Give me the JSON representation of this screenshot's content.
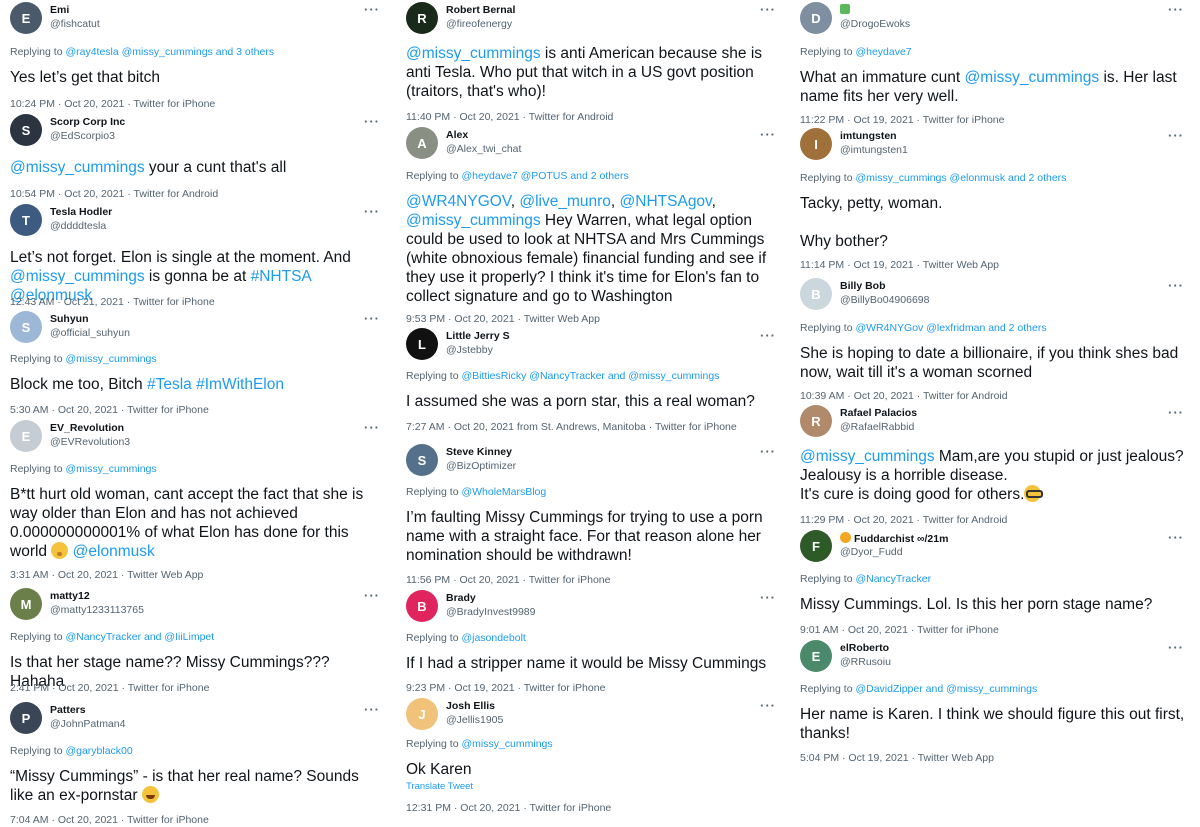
{
  "columns": [
    [
      {
        "name": "Emi",
        "handle": "@fishcatut",
        "avatar_color": "#4a5a6a",
        "reply_prefix": "Replying to ",
        "reply_to": "@ray4tesla @missy_cummings and 3 others",
        "body": [
          {
            "t": "Yes let’s get that bitch"
          }
        ],
        "meta": "10:24 PM · Oct 20, 2021 · Twitter for iPhone"
      },
      {
        "name": "Scorp Corp Inc",
        "handle": "@EdScorpio3",
        "avatar_color": "#2b3440",
        "body": [
          {
            "t": "@missy_cummings",
            "link": true
          },
          {
            "t": " your a cunt that's all"
          }
        ],
        "meta": "10:54 PM · Oct 20, 2021 · Twitter for Android"
      },
      {
        "name": "Tesla Hodler",
        "handle": "@ddddtesla",
        "avatar_color": "#3d5a80",
        "body": [
          {
            "t": "Let’s not forget. Elon is single at the moment. And "
          },
          {
            "t": "@missy_cummings",
            "link": true
          },
          {
            "t": " is gonna be at "
          },
          {
            "t": "#NHTSA",
            "link": true
          },
          {
            "t": " "
          },
          {
            "t": "@elonmusk",
            "link": true
          }
        ],
        "meta": "12:43 AM · Oct 21, 2021 · Twitter for iPhone"
      },
      {
        "name": "Suhyun",
        "handle": "@official_suhyun",
        "avatar_color": "#9db7d6",
        "reply_prefix": "Replying to ",
        "reply_to": "@missy_cummings",
        "body": [
          {
            "t": "Block me too, Bitch "
          },
          {
            "t": "#Tesla",
            "link": true
          },
          {
            "t": " "
          },
          {
            "t": "#ImWithElon",
            "link": true
          }
        ],
        "meta": "5:30 AM · Oct 20, 2021 · Twitter for iPhone"
      },
      {
        "name": "EV_Revolution",
        "handle": "@EVRevolution3",
        "avatar_color": "#c5ccd3",
        "reply_prefix": "Replying to ",
        "reply_to": "@missy_cummings",
        "body": [
          {
            "t": "B*tt hurt old woman, cant accept the fact that she is way older than Elon and has not achieved 0.000000000001% of what Elon has done for this world "
          },
          {
            "emoji": "hush"
          },
          {
            "t": " "
          },
          {
            "t": "@elonmusk",
            "link": true
          }
        ],
        "meta": "3:31 AM · Oct 20, 2021 · Twitter Web App"
      },
      {
        "name": "matty12",
        "handle": "@matty1233113765",
        "avatar_color": "#6b7f4a",
        "reply_prefix": "Replying to ",
        "reply_to": "@NancyTracker and @IiiLimpet",
        "body": [
          {
            "t": "Is that her stage name?? Missy Cummings???  Hahaha"
          }
        ],
        "meta": "2:41 PM · Oct 20, 2021 · Twitter for iPhone"
      },
      {
        "name": "Patters",
        "handle": "@JohnPatman4",
        "avatar_color": "#3a4556",
        "reply_prefix": "Replying to ",
        "reply_to": "@garyblack00",
        "body": [
          {
            "t": "“Missy Cummings” - is that her real name? Sounds like an ex-pornstar "
          },
          {
            "emoji": "joy"
          }
        ],
        "meta": "7:04 AM · Oct 20, 2021 · Twitter for iPhone"
      }
    ],
    [
      {
        "name": "Robert Bernal",
        "handle": "@fireofenergy",
        "avatar_color": "#1a2a1a",
        "body": [
          {
            "t": "@missy_cummings",
            "link": true
          },
          {
            "t": " is anti American because she is anti Tesla. Who put that witch in a US govt position (traitors, that's who)!"
          }
        ],
        "meta": "11:40 PM · Oct 20, 2021 · Twitter for Android"
      },
      {
        "name": "Alex",
        "handle": "@Alex_twi_chat",
        "avatar_color": "#8a8f84",
        "reply_prefix": "Replying to ",
        "reply_to": "@heydave7 @POTUS and 2 others",
        "body": [
          {
            "t": "@WR4NYGOV",
            "link": true
          },
          {
            "t": ", "
          },
          {
            "t": "@live_munro",
            "link": true
          },
          {
            "t": ", "
          },
          {
            "t": "@NHTSAgov",
            "link": true
          },
          {
            "t": ", "
          },
          {
            "t": "@missy_cummings",
            "link": true
          },
          {
            "t": " Hey Warren, what legal option could be used to look at NHTSA and Mrs Cummings (white obnoxious female) financial funding and  see if they use it properly? I think it's time for Elon's fan to collect signature and go to Washington"
          }
        ],
        "meta": "9:53 PM · Oct 20, 2021 · Twitter Web App"
      },
      {
        "name": "Little Jerry S",
        "handle": "@Jstebby",
        "avatar_color": "#111111",
        "reply_prefix": "Replying to ",
        "reply_to": "@BittiesRicky @NancyTracker and @missy_cummings",
        "body": [
          {
            "t": "I assumed she was a porn star, this a real woman?"
          }
        ],
        "meta": "7:27 AM · Oct 20, 2021 from St. Andrews, Manitoba · Twitter for iPhone"
      },
      {
        "name": "Steve Kinney",
        "handle": "@BizOptimizer",
        "avatar_color": "#55708a",
        "reply_prefix": "Replying to ",
        "reply_to": "@WholeMarsBlog",
        "body": [
          {
            "t": "I’m faulting Missy Cummings for trying to use a porn name with a straight face.  For that reason alone her nomination should be withdrawn!"
          }
        ],
        "meta": "11:56 PM · Oct 20, 2021 · Twitter for iPhone"
      },
      {
        "name": "Brady",
        "handle": "@BradyInvest9989",
        "avatar_color": "#e0245e",
        "reply_prefix": "Replying to ",
        "reply_to": "@jasondebolt",
        "body": [
          {
            "t": "If I had a stripper name it would be Missy Cummings"
          }
        ],
        "meta": "9:23 PM · Oct 19, 2021 · Twitter for iPhone"
      },
      {
        "name": "Josh Ellis",
        "handle": "@Jellis1905",
        "avatar_color": "#f0c27a",
        "reply_prefix": "Replying to ",
        "reply_to": "@missy_cummings",
        "body": [
          {
            "t": "Ok Karen"
          }
        ],
        "translate": "Translate Tweet",
        "meta": "12:31 PM · Oct 20, 2021 · Twitter for iPhone"
      }
    ],
    [
      {
        "name": "",
        "handle": "@DrogoEwoks",
        "avatar_color": "#7d8fa1",
        "green_badge": true,
        "reply_prefix": "Replying to ",
        "reply_to": "@heydave7",
        "body": [
          {
            "t": "What an immature cunt "
          },
          {
            "t": "@missy_cummings",
            "link": true
          },
          {
            "t": " is. Her last name fits her very well."
          }
        ],
        "meta": "11:22 PM · Oct 19, 2021 · Twitter for iPhone"
      },
      {
        "name": "imtungsten",
        "handle": "@imtungsten1",
        "avatar_color": "#a0703a",
        "reply_prefix": "Replying to ",
        "reply_to": "@missy_cummings @elonmusk and 2 others",
        "body": [
          {
            "t": "Tacky, petty, woman."
          },
          {
            "br": true
          },
          {
            "br": true
          },
          {
            "t": "Why bother?"
          }
        ],
        "meta": "11:14 PM · Oct 19, 2021 · Twitter Web App"
      },
      {
        "name": "Billy Bob",
        "handle": "@BillyBo04906698",
        "avatar_color": "#ccd6dd",
        "reply_prefix": "Replying to ",
        "reply_to": "@WR4NYGov @lexfridman and 2 others",
        "body": [
          {
            "t": "She is hoping to date a billionaire, if you think shes bad now, wait till it's a woman scorned"
          }
        ],
        "meta": "10:39 AM · Oct 20, 2021 · Twitter for Android"
      },
      {
        "name": "Rafael Palacios",
        "handle": "@RafaelRabbid",
        "avatar_color": "#b08a6a",
        "body": [
          {
            "t": "@missy_cummings",
            "link": true
          },
          {
            "t": " Mam,are you stupid or just jealous? Jealousy is a horrible disease."
          },
          {
            "br": true
          },
          {
            "t": "It's cure is doing good for others."
          },
          {
            "emoji": "glasses"
          }
        ],
        "meta": "11:29 PM · Oct 20, 2021 · Twitter for Android"
      },
      {
        "name": "Fuddarchist ∞/21m",
        "handle": "@Dyor_Fudd",
        "avatar_color": "#2d5a27",
        "badge_emoji": true,
        "reply_prefix": "Replying to ",
        "reply_to": "@NancyTracker",
        "body": [
          {
            "t": "Missy Cummings. Lol. Is this her porn stage name?"
          }
        ],
        "meta": "9:01 AM · Oct 20, 2021 · Twitter for iPhone"
      },
      {
        "name": "elRoberto",
        "handle": "@RRusoiu",
        "avatar_color": "#4a8a6a",
        "reply_prefix": "Replying to ",
        "reply_to": "@DavidZipper and @missy_cummings",
        "body": [
          {
            "t": "Her name is Karen. I think we should figure this out first, thanks!"
          }
        ],
        "meta": "5:04 PM · Oct 19, 2021 · Twitter Web App"
      }
    ]
  ],
  "more_glyph": "···"
}
